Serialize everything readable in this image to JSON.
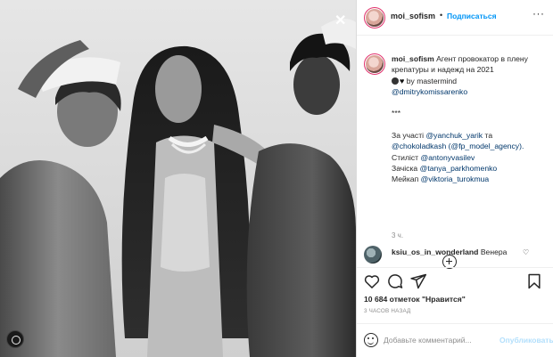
{
  "header": {
    "username": "moi_sofism",
    "dot": "•",
    "follow_label": "Подписаться",
    "more_label": "···"
  },
  "caption": {
    "username": "moi_sofism",
    "line1": "Агент провокатор в плену крепатуры и надежд на 2021",
    "by_text": "by mastermind",
    "mention_1": "@dmitrykomissarenko",
    "stars": "***",
    "with_text": "За участі",
    "mention_2": "@yanchuk_yarik",
    "and_text": "та",
    "mention_3": "@chokoladkash",
    "mention_4": "(@fp_model_agency).",
    "stylist_text": "Стиліст",
    "mention_5": "@antonyvasilev",
    "hair_text": "Зачіска",
    "mention_6": "@tanya_parkhomenko",
    "makeup_text": "Мейкап",
    "mention_7": "@viktoria_turokmua",
    "time": "3 ч."
  },
  "comment": {
    "username": "ksiu_os_in_wonderland",
    "text": "Венера",
    "like_icon": "heart-outline-icon"
  },
  "actions": {
    "icons": [
      "heart-icon",
      "comment-icon",
      "share-icon",
      "bookmark-icon"
    ]
  },
  "likes": {
    "text": "10 684 отметок \"Нравится\""
  },
  "post_date": "3 ЧАСОВ НАЗАД",
  "add_comment": {
    "placeholder": "Добавьте комментарий...",
    "post_label": "Опубликовать"
  },
  "overlay": {
    "close_label": "✕"
  },
  "colors": {
    "follow": "#0095f6",
    "link": "#00376b",
    "post_disabled": "#b2dffc",
    "muted": "#8e8e8e"
  }
}
